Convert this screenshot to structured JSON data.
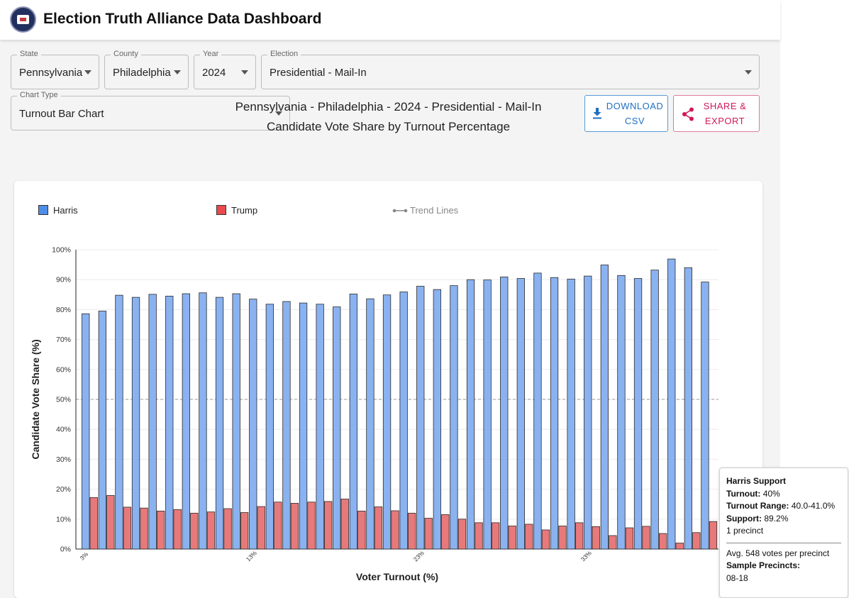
{
  "header": {
    "title": "Election Truth Alliance Data Dashboard"
  },
  "filters": {
    "state": {
      "label": "State",
      "value": "Pennsylvania"
    },
    "county": {
      "label": "County",
      "value": "Philadelphia"
    },
    "year": {
      "label": "Year",
      "value": "2024"
    },
    "election": {
      "label": "Election",
      "value": "Presidential - Mail-In"
    },
    "chart_type": {
      "label": "Chart Type",
      "value": "Turnout Bar Chart"
    }
  },
  "buttons": {
    "download_line1": "DOWNLOAD",
    "download_line2": "CSV",
    "share_line1": "SHARE &",
    "share_line2": "EXPORT"
  },
  "chart_heading": {
    "line1": "Pennsylvania - Philadelphia - 2024 - Presidential - Mail-In",
    "line2": "Candidate Vote Share by Turnout Percentage"
  },
  "legend": {
    "harris": "Harris",
    "trump": "Trump",
    "trend": "Trend Lines"
  },
  "colors": {
    "harris": "#8ab2f0",
    "trump": "#e8797b",
    "accent_blue": "#1f6fc2",
    "accent_pink": "#d0185a"
  },
  "chart_data": {
    "type": "bar",
    "xlabel": "Voter Turnout (%)",
    "ylabel": "Candidate Vote Share (%)",
    "ylim": [
      0,
      100
    ],
    "yticks": [
      "0%",
      "10%",
      "20%",
      "30%",
      "40%",
      "50%",
      "60%",
      "70%",
      "80%",
      "90%",
      "100%"
    ],
    "xtick_labels": [
      {
        "index": 0,
        "label": "3%"
      },
      {
        "index": 10,
        "label": "13%"
      },
      {
        "index": 20,
        "label": "23%"
      },
      {
        "index": 30,
        "label": "33%"
      }
    ],
    "reference_line": 50,
    "grid": true,
    "legend_position": "top",
    "series": [
      {
        "name": "Harris",
        "values": [
          78.6,
          79.5,
          84.8,
          84.1,
          85.1,
          84.5,
          85.3,
          85.6,
          84.1,
          85.3,
          83.5,
          81.8,
          82.7,
          82.2,
          81.8,
          80.9,
          85.2,
          83.6,
          84.9,
          85.9,
          87.8,
          86.7,
          88.0,
          90.0,
          89.9,
          90.9,
          90.4,
          92.2,
          90.7,
          90.2,
          91.2,
          94.9,
          91.4,
          90.4,
          93.2,
          96.9,
          94.0,
          89.2
        ]
      },
      {
        "name": "Trump",
        "values": [
          17.2,
          17.9,
          14.0,
          13.7,
          12.7,
          13.2,
          12.0,
          12.4,
          13.5,
          12.2,
          14.2,
          15.7,
          15.3,
          15.7,
          15.9,
          16.7,
          12.7,
          14.1,
          12.8,
          12.0,
          10.3,
          11.5,
          10.0,
          8.8,
          8.8,
          7.7,
          8.3,
          6.4,
          7.7,
          8.8,
          7.5,
          4.5,
          7.1,
          7.6,
          5.2,
          2.0,
          5.5,
          9.2
        ]
      }
    ]
  },
  "tooltip": {
    "title": "Harris Support",
    "turnout_label": "Turnout:",
    "turnout_value": "40%",
    "range_label": "Turnout Range:",
    "range_value": "40.0-41.0%",
    "support_label": "Support:",
    "support_value": "89.2%",
    "precinct_count": "1 precinct",
    "avg_votes": "Avg. 548 votes per precinct",
    "sample_label": "Sample Precincts:",
    "sample_value": "08-18"
  }
}
